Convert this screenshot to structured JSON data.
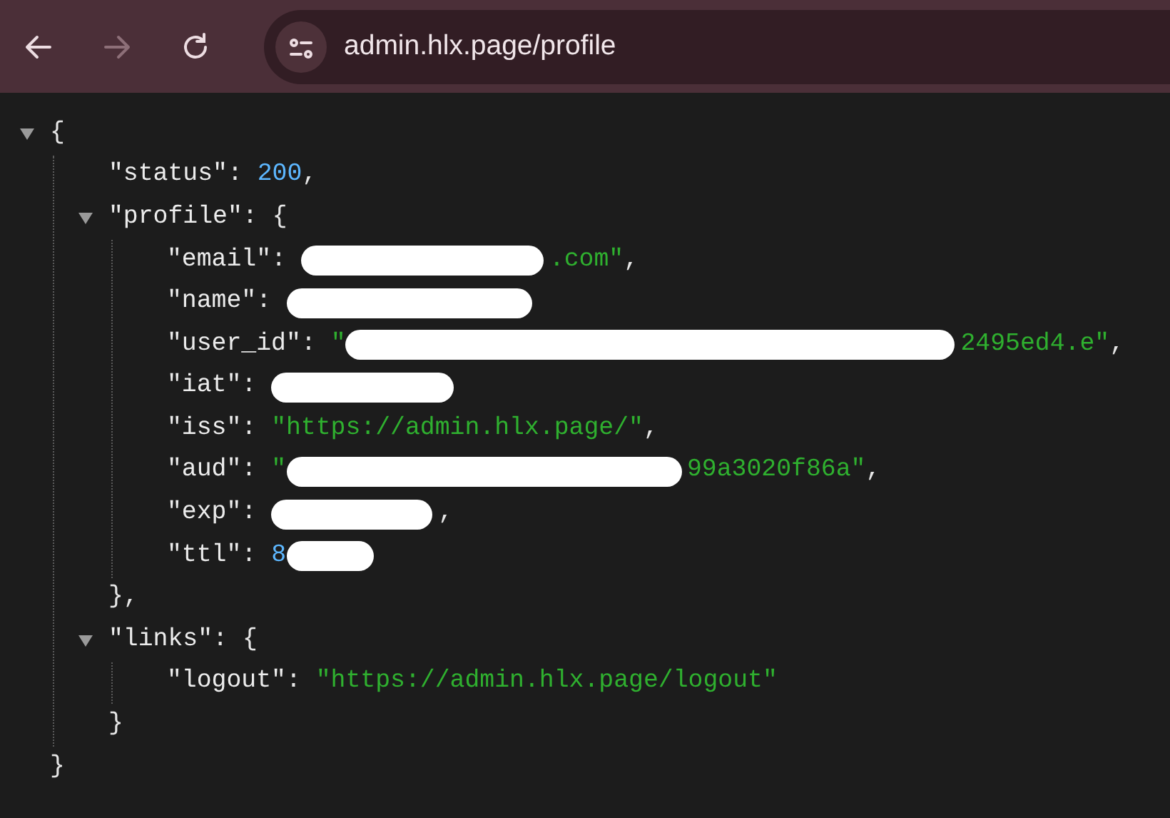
{
  "browser": {
    "url": "admin.hlx.page/profile",
    "back_disabled": false,
    "forward_disabled": true
  },
  "json_view": {
    "expanded": true,
    "open": [
      {
        "kind": "punct",
        "text": "{"
      }
    ],
    "close": [
      {
        "kind": "punct",
        "text": "}"
      }
    ],
    "children": [
      {
        "parts": [
          {
            "kind": "key",
            "text": "\"status\""
          },
          {
            "kind": "colon",
            "text": ":"
          },
          {
            "kind": "number",
            "text": "200"
          },
          {
            "kind": "punct",
            "text": ","
          }
        ]
      },
      {
        "expanded": true,
        "open": [
          {
            "kind": "key",
            "text": "\"profile\""
          },
          {
            "kind": "colon",
            "text": ":"
          },
          {
            "kind": "punct",
            "text": "{"
          }
        ],
        "close": [
          {
            "kind": "punct",
            "text": "}"
          },
          {
            "kind": "punct",
            "text": ","
          }
        ],
        "children": [
          {
            "parts": [
              {
                "kind": "key",
                "text": "\"email\""
              },
              {
                "kind": "colon",
                "text": ":"
              },
              {
                "kind": "redaction"
              },
              {
                "kind": "string",
                "text": ".com\""
              },
              {
                "kind": "punct",
                "text": ","
              }
            ]
          },
          {
            "parts": [
              {
                "kind": "key",
                "text": "\"name\""
              },
              {
                "kind": "colon",
                "text": ":"
              },
              {
                "kind": "redaction"
              }
            ]
          },
          {
            "parts": [
              {
                "kind": "key",
                "text": "\"user_id\""
              },
              {
                "kind": "colon",
                "text": ":"
              },
              {
                "kind": "string",
                "text": "\""
              },
              {
                "kind": "redaction"
              },
              {
                "kind": "string",
                "text": "2495ed4.e\""
              },
              {
                "kind": "punct",
                "text": ","
              }
            ]
          },
          {
            "parts": [
              {
                "kind": "key",
                "text": "\"iat\""
              },
              {
                "kind": "colon",
                "text": ":"
              },
              {
                "kind": "redaction"
              }
            ]
          },
          {
            "parts": [
              {
                "kind": "key",
                "text": "\"iss\""
              },
              {
                "kind": "colon",
                "text": ":"
              },
              {
                "kind": "string",
                "text": "\"https://admin.hlx.page/\""
              },
              {
                "kind": "punct",
                "text": ","
              }
            ]
          },
          {
            "parts": [
              {
                "kind": "key",
                "text": "\"aud\""
              },
              {
                "kind": "colon",
                "text": ":"
              },
              {
                "kind": "string",
                "text": "\""
              },
              {
                "kind": "redaction"
              },
              {
                "kind": "string",
                "text": "99a3020f86a\""
              },
              {
                "kind": "punct",
                "text": ","
              }
            ]
          },
          {
            "parts": [
              {
                "kind": "key",
                "text": "\"exp\""
              },
              {
                "kind": "colon",
                "text": ":"
              },
              {
                "kind": "redaction"
              },
              {
                "kind": "punct",
                "text": ","
              }
            ]
          },
          {
            "parts": [
              {
                "kind": "key",
                "text": "\"ttl\""
              },
              {
                "kind": "colon",
                "text": ":"
              },
              {
                "kind": "number",
                "text": "8"
              },
              {
                "kind": "redaction"
              }
            ]
          }
        ]
      },
      {
        "expanded": true,
        "open": [
          {
            "kind": "key",
            "text": "\"links\""
          },
          {
            "kind": "colon",
            "text": ":"
          },
          {
            "kind": "punct",
            "text": "{"
          }
        ],
        "close": [
          {
            "kind": "punct",
            "text": "}"
          }
        ],
        "children": [
          {
            "parts": [
              {
                "kind": "key",
                "text": "\"logout\""
              },
              {
                "kind": "colon",
                "text": ":"
              },
              {
                "kind": "string",
                "text": "\"https://admin.hlx.page/logout\""
              }
            ]
          }
        ]
      }
    ]
  }
}
